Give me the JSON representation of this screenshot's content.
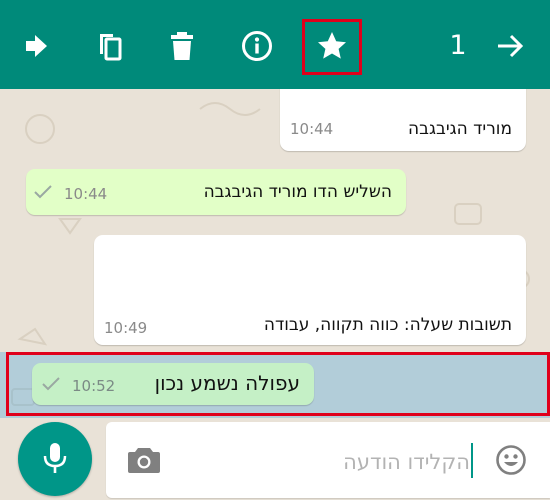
{
  "topbar": {
    "selected_count": "1",
    "actions": [
      "forward-icon",
      "copy-icon",
      "delete-icon",
      "info-icon",
      "star-icon"
    ],
    "back_icon": "arrow-right-icon",
    "accent": "#008a7a",
    "highlight": "#e0001b"
  },
  "messages": [
    {
      "kind": "incoming",
      "sender_fragment": "",
      "text": "מוריד הגיבגבה",
      "time": "10:44"
    },
    {
      "kind": "outgoing",
      "text": "השליש הדו מוריד הגיבגבה",
      "time": "10:44",
      "ticks": "single-check"
    },
    {
      "kind": "incoming",
      "sender_fragment": "",
      "text": "תשובות שעלה: כווה תקווה, עבודה",
      "time": "10:49"
    },
    {
      "kind": "outgoing",
      "selected": true,
      "text": "עפולה נשמע נכון",
      "time": "10:52",
      "ticks": "single-check"
    }
  ],
  "composer": {
    "placeholder": "הקלידו הודעה",
    "value": "",
    "mic_icon": "mic-icon",
    "camera_icon": "camera-icon",
    "emoji_icon": "emoji-icon"
  }
}
